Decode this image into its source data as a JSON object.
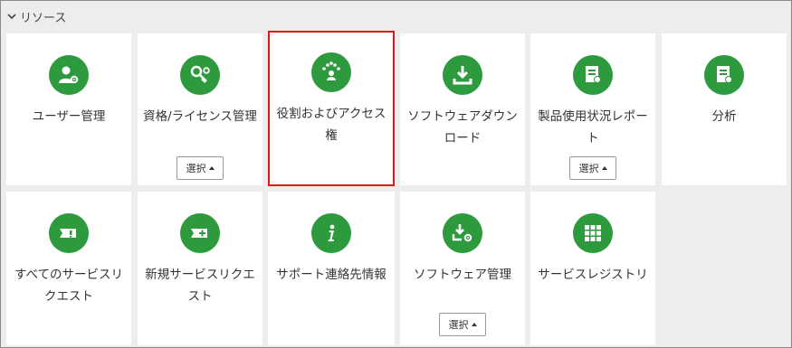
{
  "section": {
    "title": "リソース",
    "icon": "chevron-down-icon"
  },
  "colors": {
    "accent": "#2e9a3e",
    "selection": "#e01818"
  },
  "tiles": [
    {
      "label": "ユーザー管理",
      "icon": "user-gear-icon"
    },
    {
      "label": "資格/ライセンス管理",
      "icon": "key-gear-icon",
      "button": "選択"
    },
    {
      "label": "役割およびアクセス権",
      "icon": "people-network-icon",
      "selected": true
    },
    {
      "label": "ソフトウェアダウンロード",
      "icon": "download-icon"
    },
    {
      "label": "製品使用状況レポート",
      "icon": "certificate-report-icon",
      "button": "選択"
    },
    {
      "label": "分析",
      "icon": "certificate-analysis-icon"
    },
    {
      "label": "すべてのサービスリクエスト",
      "icon": "ticket-exclamation-icon"
    },
    {
      "label": "新規サービスリクエスト",
      "icon": "ticket-plus-icon"
    },
    {
      "label": "サポート連絡先情報",
      "icon": "info-icon"
    },
    {
      "label": "ソフトウェア管理",
      "icon": "download-gear-icon",
      "button": "選択"
    },
    {
      "label": "サービスレジストリ",
      "icon": "grid-icon"
    }
  ]
}
